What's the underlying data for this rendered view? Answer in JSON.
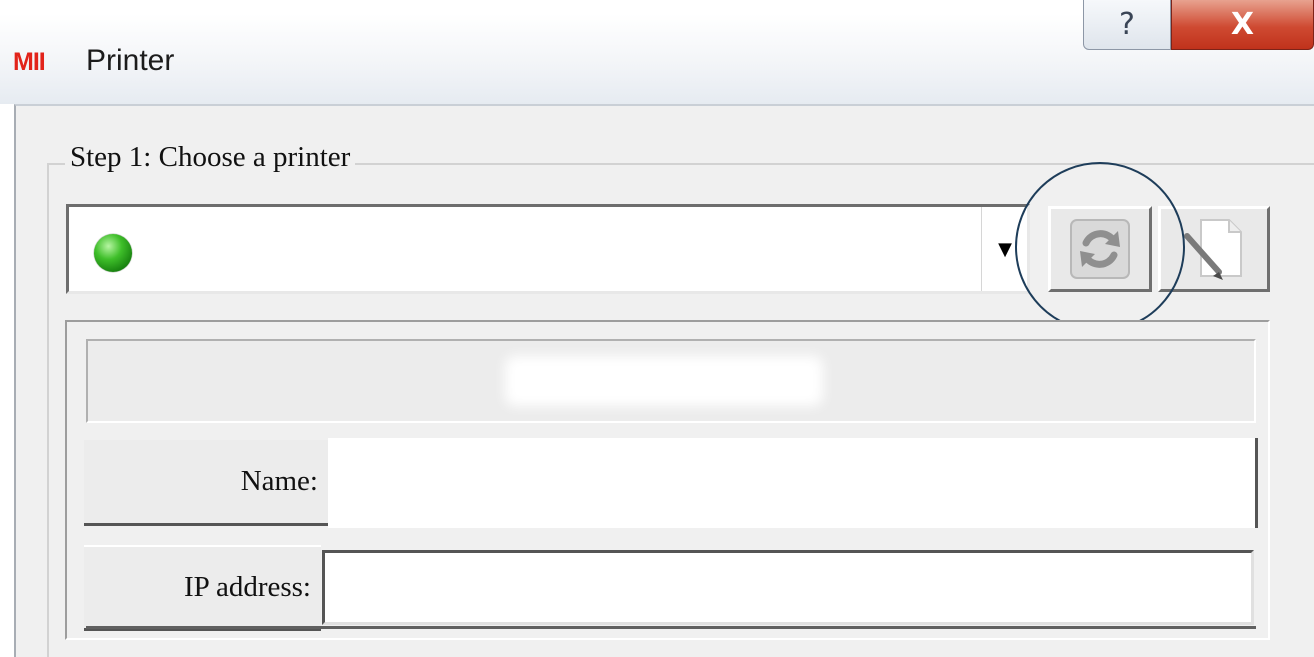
{
  "window": {
    "logo_text": "MII",
    "title": "Printer",
    "help_label": "?",
    "close_label": "X"
  },
  "step1": {
    "group_label": "Step 1: Choose a printer",
    "printer_combo": {
      "selected_value": "",
      "status_color": "#2fa81e",
      "dropdown_arrow": "▼"
    },
    "buttons": {
      "refresh_icon": "refresh-icon",
      "edit_icon": "edit-icon"
    },
    "details": {
      "name_label": "Name:",
      "name_value": "",
      "ip_label": "IP address:",
      "ip_value": ""
    }
  },
  "colors": {
    "highlight_ring": "#1e3d5a",
    "close_button": "#c7351f",
    "logo": "#e2231a"
  }
}
